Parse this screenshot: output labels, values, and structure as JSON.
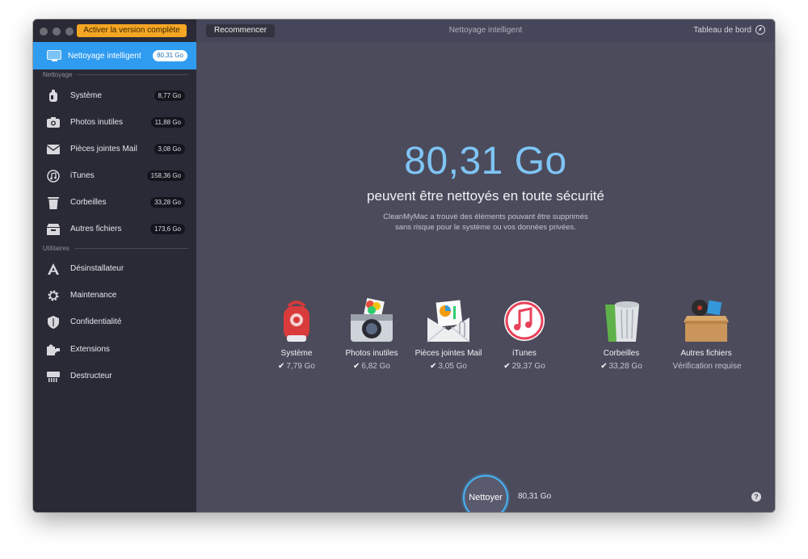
{
  "window": {
    "activate_label": "Activer la version complète",
    "title": "Nettoyage intelligent"
  },
  "toolbar": {
    "restart_label": "Recommencer",
    "dashboard_label": "Tableau de bord"
  },
  "sidebar": {
    "smart": {
      "label": "Nettoyage intelligent",
      "size": "80,31 Go",
      "icon": "monitor-icon"
    },
    "section_cleaning": "Nettoyage",
    "cleaning_items": [
      {
        "label": "Système",
        "size": "8,77 Go",
        "icon": "vacuum-icon"
      },
      {
        "label": "Photos inutiles",
        "size": "11,88 Go",
        "icon": "camera-icon"
      },
      {
        "label": "Pièces jointes Mail",
        "size": "3,08 Go",
        "icon": "envelope-icon"
      },
      {
        "label": "iTunes",
        "size": "158,36 Go",
        "icon": "music-note-icon"
      },
      {
        "label": "Corbeilles",
        "size": "33,28 Go",
        "icon": "trash-icon"
      },
      {
        "label": "Autres fichiers",
        "size": "173,6 Go",
        "icon": "box-icon"
      }
    ],
    "section_utilities": "Utilitaires",
    "utility_items": [
      {
        "label": "Désinstallateur",
        "icon": "uninstaller-icon"
      },
      {
        "label": "Maintenance",
        "icon": "gear-icon"
      },
      {
        "label": "Confidentialité",
        "icon": "shield-icon"
      },
      {
        "label": "Extensions",
        "icon": "puzzle-icon"
      },
      {
        "label": "Destructeur",
        "icon": "shredder-icon"
      }
    ]
  },
  "main": {
    "total_size": "80,31 Go",
    "headline": "peuvent être nettoyés en toute sécurité",
    "description_line1": "CleanMyMac a trouvé des éléments pouvant être supprimés",
    "description_line2": "sans risque pour le système ou vos données privées.",
    "categories": [
      {
        "name": "Système",
        "check": "✔",
        "size": "7,79 Go"
      },
      {
        "name": "Photos inutiles",
        "check": "✔",
        "size": "6,82 Go"
      },
      {
        "name": "Pièces jointes Mail",
        "check": "✔",
        "size": "3,05 Go"
      },
      {
        "name": "iTunes",
        "check": "✔",
        "size": "29,37 Go"
      },
      {
        "name": "Corbeilles",
        "check": "✔",
        "size": "33,28 Go"
      },
      {
        "name": "Autres fichiers",
        "check": "",
        "size": "Vérification requise"
      }
    ],
    "clean_button_label": "Nettoyer",
    "clean_size": "80,31 Go",
    "help_label": "?"
  },
  "colors": {
    "accent": "#2f9cf0",
    "activate": "#f5a623",
    "sidebar_bg": "#2a2a36",
    "main_bg": "#4b4b5b",
    "size_text": "#7fc4f5"
  }
}
